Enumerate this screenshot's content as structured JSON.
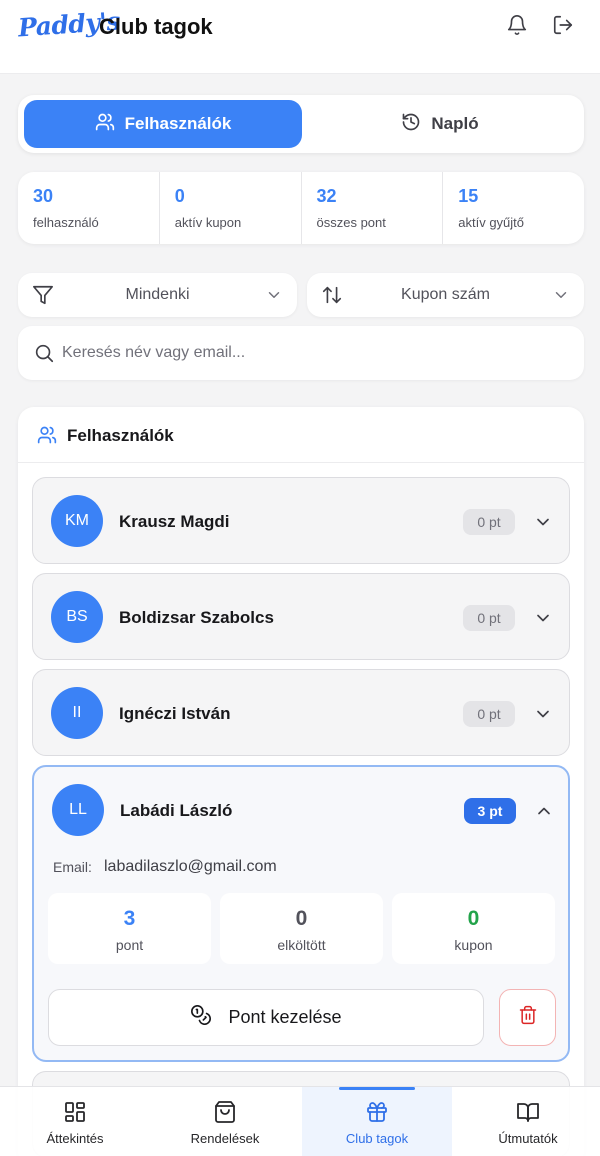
{
  "header": {
    "logo": "Paddy's",
    "title": "Club tagok",
    "bell_icon": "bell-icon",
    "logout_icon": "logout-icon"
  },
  "tabs": [
    {
      "label": "Felhasználók",
      "icon": "users-icon",
      "active": true
    },
    {
      "label": "Napló",
      "icon": "history-icon",
      "active": false
    }
  ],
  "stats": [
    {
      "value": "30",
      "label": "felhasználó"
    },
    {
      "value": "0",
      "label": "aktív kupon"
    },
    {
      "value": "32",
      "label": "összes pont"
    },
    {
      "value": "15",
      "label": "aktív gyűjtő"
    }
  ],
  "filters": {
    "audience": {
      "label": "Mindenki",
      "icon": "filter-icon"
    },
    "sort": {
      "label": "Kupon szám",
      "icon": "sort-icon"
    }
  },
  "search": {
    "placeholder": "Keresés név vagy email...",
    "value": ""
  },
  "users_panel": {
    "title": "Felhasználók",
    "users": [
      {
        "initials": "KM",
        "name": "Krausz Magdi",
        "points": "0 pt"
      },
      {
        "initials": "BS",
        "name": "Boldizsar Szabolcs",
        "points": "0 pt"
      },
      {
        "initials": "II",
        "name": "Ignéczi István",
        "points": "0 pt"
      },
      {
        "initials": "LL",
        "name": "Labádi László",
        "points": "3 pt",
        "expanded": true,
        "email_label": "Email:",
        "email": "labadilaszlo@gmail.com",
        "metrics": [
          {
            "value": "3",
            "label": "pont",
            "color": "#3b82f6"
          },
          {
            "value": "0",
            "label": "elköltött",
            "color": "#52525b"
          },
          {
            "value": "0",
            "label": "kupon",
            "color": "#22a34a"
          }
        ],
        "manage_label": "Pont kezelése"
      }
    ]
  },
  "bottom_nav": [
    {
      "label": "Áttekintés",
      "icon": "dashboard-icon",
      "active": false
    },
    {
      "label": "Rendelések",
      "icon": "shopping-bag-icon",
      "active": false
    },
    {
      "label": "Club tagok",
      "icon": "gift-icon",
      "active": true
    },
    {
      "label": "Útmutatók",
      "icon": "book-icon",
      "active": false
    }
  ],
  "colors": {
    "accent": "#3b82f6",
    "accent_dark": "#2f6fe8",
    "success": "#22a34a",
    "danger": "#dc2626",
    "background": "#f4f4f5"
  }
}
